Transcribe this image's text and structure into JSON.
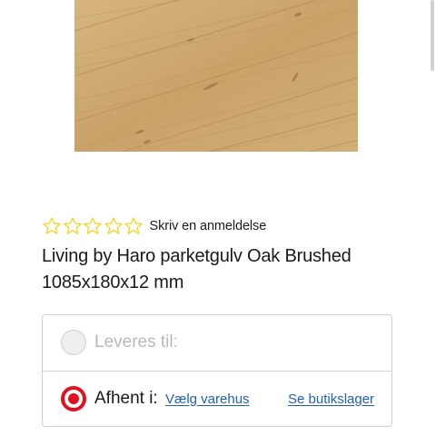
{
  "rating": {
    "stars_total": 5,
    "stars_filled": 0,
    "star_color": "#f5d20f",
    "review_link": "Skriv en anmeldelse"
  },
  "product": {
    "title": "Living by Haro parketgulv Oak Brushed 1085x180x12 mm"
  },
  "delivery": {
    "ship_label": "Leveres til:",
    "ship_selected": false,
    "pickup_label": "Afhent i:",
    "pickup_selected": true,
    "choose_store_link": "Vælg varehus",
    "see_stock_link": "Se butikslager",
    "accent_color": "#e3101e",
    "link_color": "#1f5fbf"
  }
}
